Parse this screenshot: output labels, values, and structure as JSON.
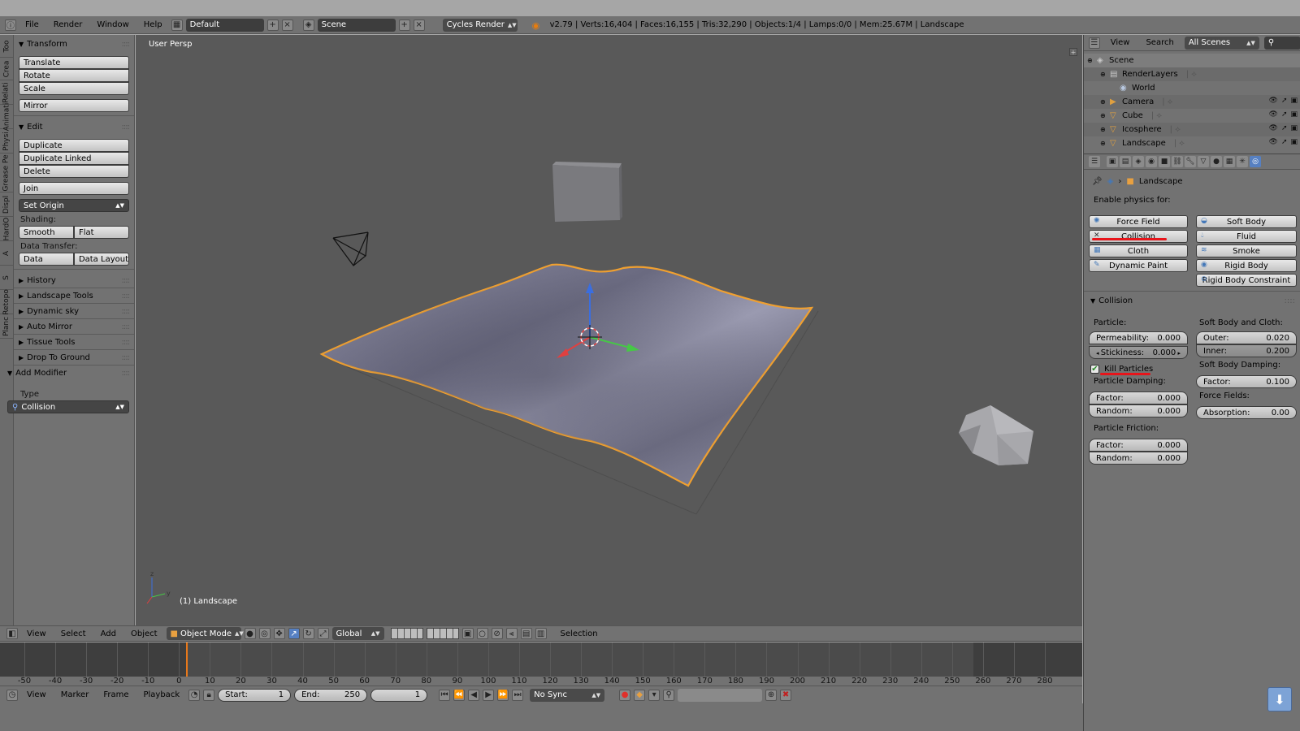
{
  "topbar": {
    "menu": [
      "File",
      "Render",
      "Window",
      "Help"
    ],
    "layout": "Default",
    "scene": "Scene",
    "engine": "Cycles Render",
    "stats": "v2.79 | Verts:16,404 | Faces:16,155 | Tris:32,290 | Objects:1/4 | Lamps:0/0 | Mem:25.67M | Landscape"
  },
  "tool_tabs": [
    "Too",
    "Crea",
    "Relati",
    "Animati",
    "Physi",
    "Grease Pe",
    "Displ",
    "HardO",
    "A",
    "S",
    "Retopo",
    "Planc"
  ],
  "toolshelf": {
    "transform": {
      "title": "Transform",
      "buttons": [
        "Translate",
        "Rotate",
        "Scale"
      ],
      "mirror": "Mirror"
    },
    "edit": {
      "title": "Edit",
      "buttons": [
        "Duplicate",
        "Duplicate Linked",
        "Delete"
      ],
      "join": "Join",
      "set_origin": "Set Origin",
      "shading_label": "Shading:",
      "smooth": "Smooth",
      "flat": "Flat",
      "data_transfer_label": "Data Transfer:",
      "data": "Data",
      "data_layout": "Data Layout"
    },
    "panels": [
      "History",
      "Landscape Tools",
      "Dynamic sky",
      "Auto Mirror",
      "Tissue Tools",
      "Drop To Ground"
    ],
    "add_modifier": {
      "title": "Add Modifier",
      "type_label": "Type",
      "type_value": "Collision"
    }
  },
  "viewport": {
    "view_label": "User Persp",
    "object_label": "(1) Landscape"
  },
  "vp_header": {
    "menu": [
      "View",
      "Select",
      "Add",
      "Object"
    ],
    "mode": "Object Mode",
    "orientation": "Global",
    "selection": "Selection"
  },
  "timeline": {
    "ticks": [
      "-50",
      "-40",
      "-30",
      "-20",
      "-10",
      "0",
      "10",
      "20",
      "30",
      "40",
      "50",
      "60",
      "70",
      "80",
      "90",
      "100",
      "110",
      "120",
      "130",
      "140",
      "150",
      "160",
      "170",
      "180",
      "190",
      "200",
      "210",
      "220",
      "230",
      "240",
      "250",
      "260",
      "270",
      "280"
    ],
    "menu": [
      "View",
      "Marker",
      "Frame",
      "Playback"
    ],
    "start_label": "Start:",
    "start_value": "1",
    "end_label": "End:",
    "end_value": "250",
    "current": "1",
    "sync": "No Sync"
  },
  "outliner": {
    "menu": [
      "View",
      "Search"
    ],
    "filter": "All Scenes",
    "rows": [
      "Scene",
      "RenderLayers",
      "World",
      "Camera",
      "Cube",
      "Icosphere",
      "Landscape"
    ]
  },
  "properties": {
    "context": "Landscape",
    "enable_label": "Enable physics for:",
    "physics_left": [
      "Force Field",
      "Collision",
      "Cloth",
      "Dynamic Paint"
    ],
    "physics_right": [
      "Soft Body",
      "Fluid",
      "Smoke",
      "Rigid Body",
      "Rigid Body Constraint"
    ],
    "collision": {
      "title": "Collision",
      "particle_label": "Particle:",
      "permeability_label": "Permeability:",
      "permeability": "0.000",
      "stickiness_label": "Stickiness:",
      "stickiness": "0.000",
      "kill_particles": "Kill Particles",
      "particle_damping_label": "Particle Damping:",
      "pd_factor_label": "Factor:",
      "pd_factor": "0.000",
      "pd_random_label": "Random:",
      "pd_random": "0.000",
      "particle_friction_label": "Particle Friction:",
      "pf_factor_label": "Factor:",
      "pf_factor": "0.000",
      "pf_random_label": "Random:",
      "pf_random": "0.000",
      "softbody_cloth_label": "Soft Body and Cloth:",
      "outer_label": "Outer:",
      "outer": "0.020",
      "inner_label": "Inner:",
      "inner": "0.200",
      "sb_damping_label": "Soft Body Damping:",
      "sbd_factor_label": "Factor:",
      "sbd_factor": "0.100",
      "force_fields_label": "Force Fields:",
      "absorption_label": "Absorption:",
      "absorption": "0.00"
    }
  },
  "colors": {
    "selection_outline": "#f0a030",
    "highlight_mark": "#e8141a",
    "active_tab": "#5680c2"
  }
}
